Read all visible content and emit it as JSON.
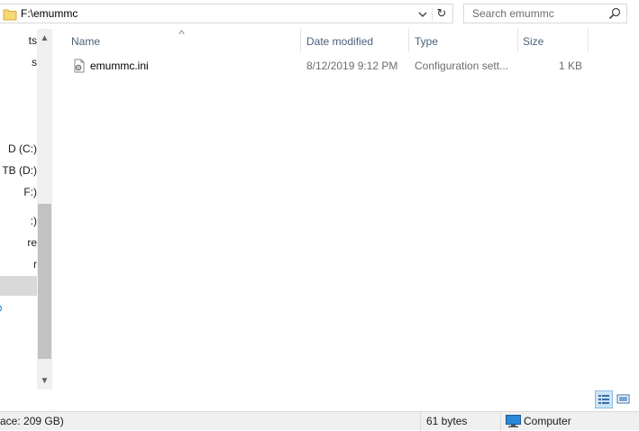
{
  "address_bar": {
    "path": "F:\\emummc",
    "folder_icon": "folder-icon",
    "dropdown_icon": "chevron-down-icon",
    "refresh_icon": "refresh-icon"
  },
  "search": {
    "placeholder": "Search emummc",
    "icon": "search-icon"
  },
  "nav_pane": {
    "items": [
      {
        "label": "ts"
      },
      {
        "label": "s"
      },
      {
        "label": "D (C:)"
      },
      {
        "label": "TB (D:)"
      },
      {
        "label": "F:)"
      },
      {
        "label": ":)"
      },
      {
        "label": "re"
      },
      {
        "label": "r"
      },
      {
        "label": ""
      }
    ]
  },
  "file_list": {
    "columns": [
      {
        "label": "Name"
      },
      {
        "label": "Date modified"
      },
      {
        "label": "Type"
      },
      {
        "label": "Size"
      }
    ],
    "rows": [
      {
        "name": "emummc.ini",
        "date_modified": "8/12/2019 9:12 PM",
        "type": "Configuration sett...",
        "size": "1 KB",
        "icon": "config-file-icon"
      }
    ]
  },
  "view_buttons": {
    "details": "details-view-icon",
    "tiles": "large-icons-view-icon"
  },
  "status_bar": {
    "free_space": "ace: 209 GB)",
    "selection_size": "61 bytes",
    "location": "Computer",
    "location_icon": "computer-icon"
  },
  "colors": {
    "accent": "#0078d7",
    "selected_nav": "#d9d9d9",
    "header_text": "#4c607a"
  }
}
